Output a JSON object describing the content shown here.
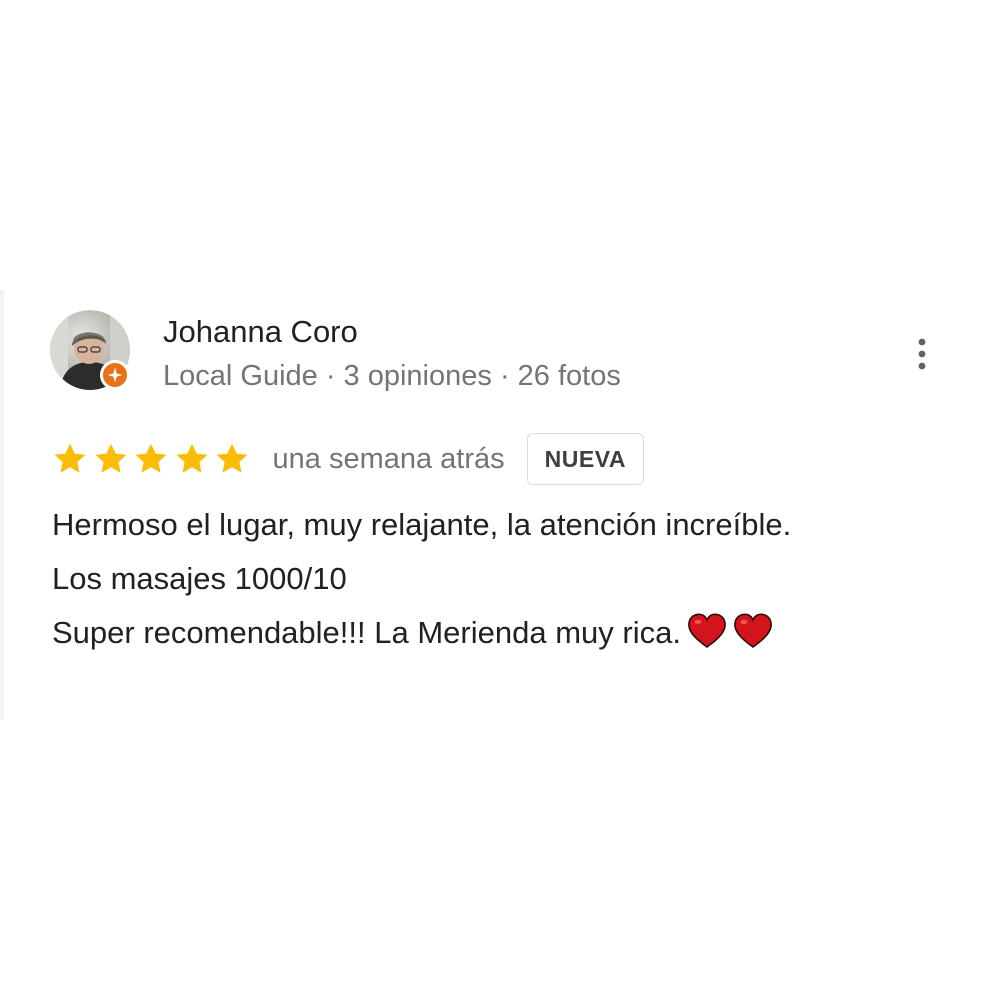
{
  "review": {
    "reviewer": {
      "name": "Johanna Coro",
      "meta": "Local Guide · 3 opiniones · 26 fotos",
      "avatar_icon": "user-photo",
      "badge_icon": "local-guide-star-icon",
      "badge_color": "#e8711a"
    },
    "more_icon": "more-vert-icon",
    "rating": {
      "stars": 5,
      "max": 5,
      "star_color": "#fbbc04"
    },
    "date": "una semana atrás",
    "badge": "NUEVA",
    "text_lines": [
      "Hermoso el lugar, muy relajante, la atención increíble.",
      "Los masajes 1000/10",
      "Super recomendable!!! La Merienda muy rica."
    ],
    "emoji": [
      "red-heart-icon",
      "red-heart-icon"
    ]
  }
}
